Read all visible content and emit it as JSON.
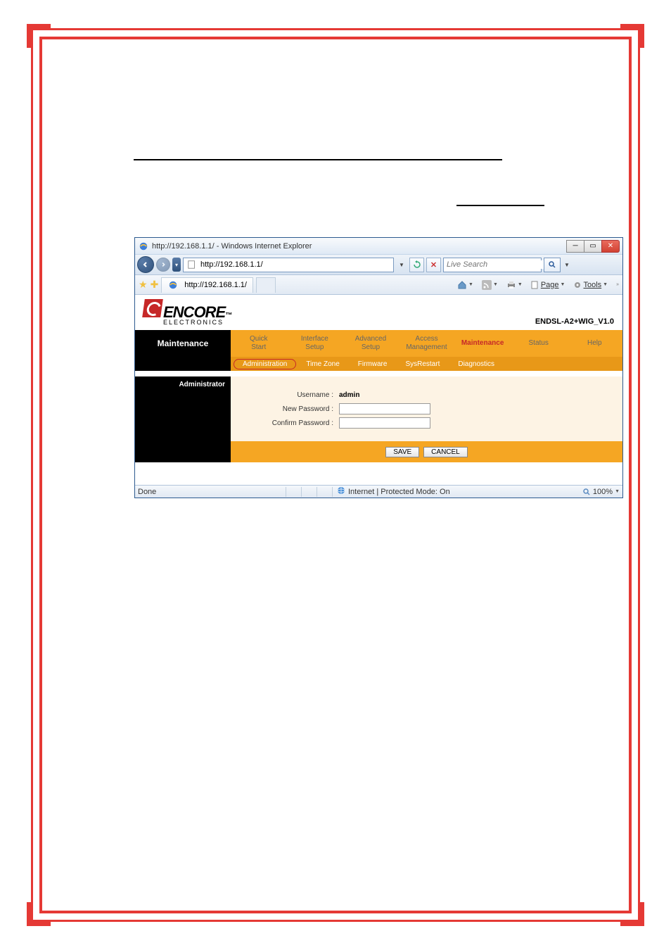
{
  "titlebar": {
    "text": "http://192.168.1.1/ - Windows Internet Explorer"
  },
  "addressbar": {
    "url": "http://192.168.1.1/",
    "search_placeholder": "Live Search"
  },
  "tabbar": {
    "active_tab": "http://192.168.1.1/",
    "page_menu": "Page",
    "tools_menu": "Tools"
  },
  "router": {
    "logo_main": "ENCORE",
    "logo_sub": "ELECTRONICS",
    "logo_tm": "™",
    "fw_version": "ENDSL-A2+WIG_V1.0",
    "section_title": "Maintenance",
    "main_tabs": [
      {
        "line1": "Quick",
        "line2": "Start"
      },
      {
        "line1": "Interface",
        "line2": "Setup"
      },
      {
        "line1": "Advanced",
        "line2": "Setup"
      },
      {
        "line1": "Access",
        "line2": "Management"
      },
      {
        "line1": "Maintenance",
        "line2": ""
      },
      {
        "line1": "Status",
        "line2": ""
      },
      {
        "line1": "Help",
        "line2": ""
      }
    ],
    "sub_tabs": [
      "Administration",
      "Time Zone",
      "Firmware",
      "SysRestart",
      "Diagnostics"
    ],
    "form": {
      "section_header": "Administrator",
      "username_label": "Username :",
      "username_value": "admin",
      "new_password_label": "New Password :",
      "new_password_value": "",
      "confirm_password_label": "Confirm Password :",
      "confirm_password_value": ""
    },
    "buttons": {
      "save": "SAVE",
      "cancel": "CANCEL"
    }
  },
  "statusbar": {
    "done": "Done",
    "zone": "Internet | Protected Mode: On",
    "zoom": "100%"
  }
}
